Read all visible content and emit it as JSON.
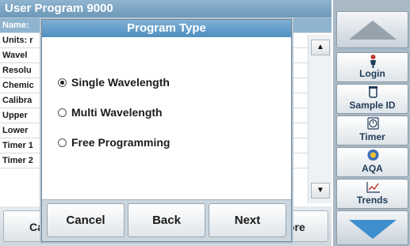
{
  "background": {
    "header_title": "User Program   9000",
    "rows": [
      "Name:",
      "Units: r",
      "Wavel",
      "Resolu",
      "Chemic",
      "Calibra",
      "Upper",
      "Lower",
      "Timer 1",
      "Timer 2"
    ],
    "bottom_left_label": "Ca",
    "bottom_right_label": "ore"
  },
  "sidebar": {
    "login_label": "Login",
    "sample_id_label": "Sample ID",
    "timer_label": "Timer",
    "aqa_label": "AQA",
    "trends_label": "Trends"
  },
  "dialog": {
    "title": "Program Type",
    "options": [
      {
        "label": "Single Wavelength",
        "selected": true
      },
      {
        "label": "Multi Wavelength",
        "selected": false
      },
      {
        "label": "Free Programming",
        "selected": false
      }
    ],
    "buttons": {
      "cancel": "Cancel",
      "back": "Back",
      "next": "Next"
    }
  },
  "colors": {
    "title_bar": "#4f8fc0",
    "down_arrow": "#3f8fcf",
    "sidebar_bg": "#a9b9c6"
  }
}
